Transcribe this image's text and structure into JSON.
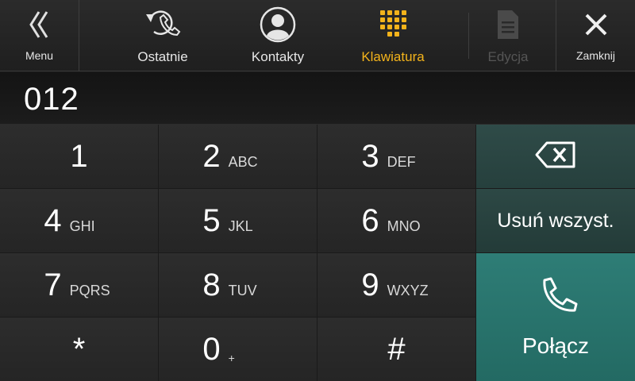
{
  "topbar": {
    "menu_label": "Menu",
    "tabs": [
      {
        "label": "Ostatnie",
        "icon": "recent-calls-icon",
        "state": "normal"
      },
      {
        "label": "Kontakty",
        "icon": "contact-person-icon",
        "state": "normal"
      },
      {
        "label": "Klawiatura",
        "icon": "keypad-icon",
        "state": "active"
      },
      {
        "label": "Edycja",
        "icon": "document-edit-icon",
        "state": "disabled"
      }
    ],
    "close_label": "Zamknij"
  },
  "display": {
    "number": "012"
  },
  "keypad": [
    {
      "digit": "1",
      "letters": ""
    },
    {
      "digit": "2",
      "letters": "ABC"
    },
    {
      "digit": "3",
      "letters": "DEF"
    },
    {
      "digit": "4",
      "letters": "GHI"
    },
    {
      "digit": "5",
      "letters": "JKL"
    },
    {
      "digit": "6",
      "letters": "MNO"
    },
    {
      "digit": "7",
      "letters": "PQRS"
    },
    {
      "digit": "8",
      "letters": "TUV"
    },
    {
      "digit": "9",
      "letters": "WXYZ"
    },
    {
      "digit": "*",
      "letters": ""
    },
    {
      "digit": "0",
      "letters": "+"
    },
    {
      "digit": "#",
      "letters": ""
    }
  ],
  "side": {
    "backspace_icon": "backspace-icon",
    "clear_all_label": "Usuń wszyst.",
    "call_label": "Połącz",
    "call_icon": "phone-handset-icon"
  },
  "colors": {
    "accent": "#f3b31b",
    "call_button": "#2a766f",
    "side_button": "#2b4643",
    "background": "#1b1b1b"
  }
}
